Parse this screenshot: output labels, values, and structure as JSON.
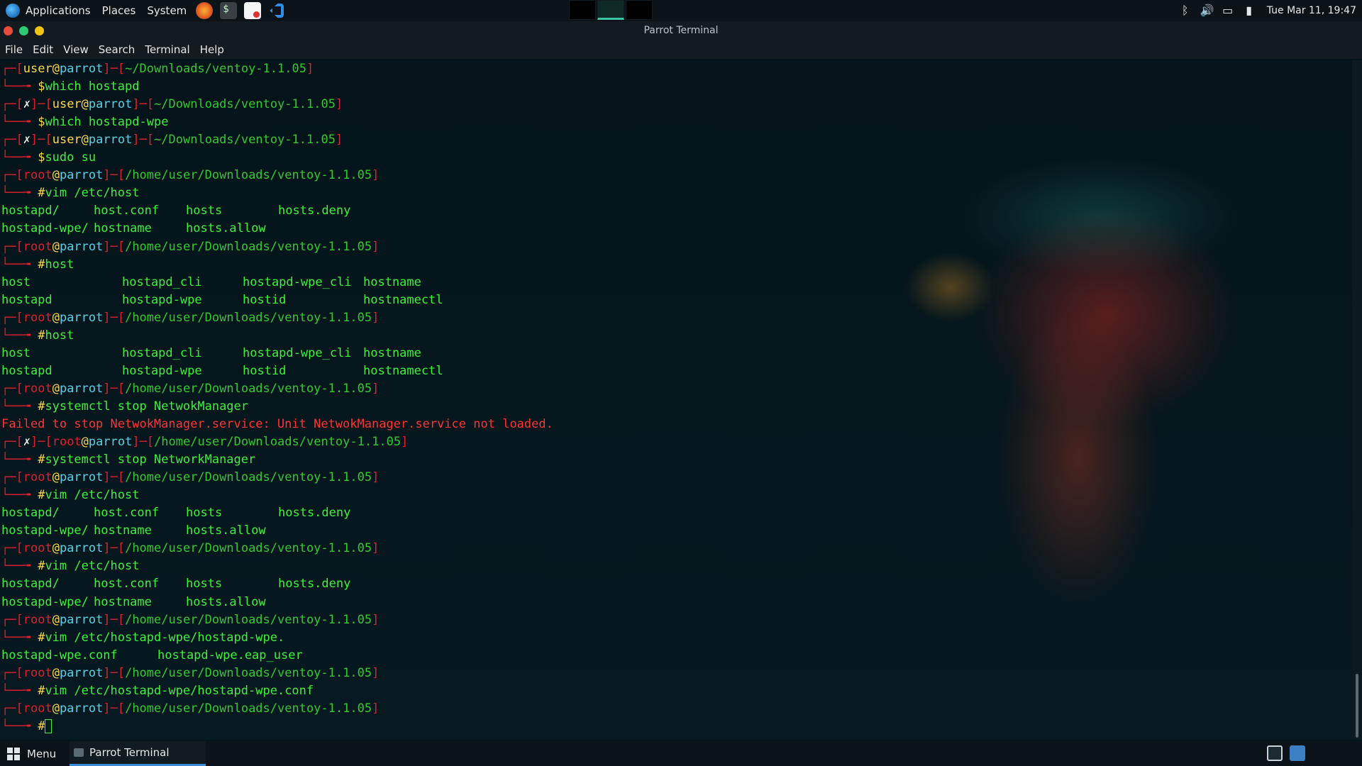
{
  "top_panel": {
    "menus": [
      "Applications",
      "Places",
      "System"
    ],
    "clock": "Tue Mar 11, 19:47"
  },
  "window": {
    "title": "Parrot Terminal",
    "menu": [
      "File",
      "Edit",
      "View",
      "Search",
      "Terminal",
      "Help"
    ]
  },
  "terminal": {
    "lines": [
      {
        "type": "prompt",
        "fail": false,
        "user": "user",
        "host": "parrot",
        "path": "~/Downloads/ventoy-1.1.05"
      },
      {
        "type": "cmd",
        "sym": "$",
        "text": "which hostapd"
      },
      {
        "type": "prompt",
        "fail": true,
        "user": "user",
        "host": "parrot",
        "path": "~/Downloads/ventoy-1.1.05"
      },
      {
        "type": "cmd",
        "sym": "$",
        "text": "which hostapd-wpe"
      },
      {
        "type": "prompt",
        "fail": true,
        "user": "user",
        "host": "parrot",
        "path": "~/Downloads/ventoy-1.1.05"
      },
      {
        "type": "cmd",
        "sym": "$",
        "text": "sudo su"
      },
      {
        "type": "prompt",
        "fail": false,
        "user": "root",
        "host": "parrot",
        "path": "/home/user/Downloads/ventoy-1.1.05"
      },
      {
        "type": "cmd",
        "sym": "#",
        "text": "vim /etc/host"
      },
      {
        "type": "cols",
        "cols": [
          "hostapd/",
          "host.conf",
          "hosts",
          "hosts.deny"
        ]
      },
      {
        "type": "cols",
        "cols": [
          "hostapd-wpe/",
          "hostname",
          "hosts.allow",
          ""
        ]
      },
      {
        "type": "prompt",
        "fail": false,
        "user": "root",
        "host": "parrot",
        "path": "/home/user/Downloads/ventoy-1.1.05"
      },
      {
        "type": "cmd",
        "sym": "#",
        "text": "host"
      },
      {
        "type": "cols4",
        "cols": [
          "host",
          "hostapd_cli",
          "hostapd-wpe_cli",
          "hostname"
        ]
      },
      {
        "type": "cols4",
        "cols": [
          "hostapd",
          "hostapd-wpe",
          "hostid",
          "hostnamectl"
        ]
      },
      {
        "type": "prompt",
        "fail": false,
        "user": "root",
        "host": "parrot",
        "path": "/home/user/Downloads/ventoy-1.1.05"
      },
      {
        "type": "cmd",
        "sym": "#",
        "text": "host"
      },
      {
        "type": "cols4",
        "cols": [
          "host",
          "hostapd_cli",
          "hostapd-wpe_cli",
          "hostname"
        ]
      },
      {
        "type": "cols4",
        "cols": [
          "hostapd",
          "hostapd-wpe",
          "hostid",
          "hostnamectl"
        ]
      },
      {
        "type": "prompt",
        "fail": false,
        "user": "root",
        "host": "parrot",
        "path": "/home/user/Downloads/ventoy-1.1.05"
      },
      {
        "type": "cmd",
        "sym": "#",
        "text": "systemctl stop NetwokManager"
      },
      {
        "type": "error",
        "text": "Failed to stop NetwokManager.service: Unit NetwokManager.service not loaded."
      },
      {
        "type": "prompt",
        "fail": true,
        "user": "root",
        "host": "parrot",
        "path": "/home/user/Downloads/ventoy-1.1.05"
      },
      {
        "type": "cmd",
        "sym": "#",
        "text": "systemctl stop NetworkManager"
      },
      {
        "type": "prompt",
        "fail": false,
        "user": "root",
        "host": "parrot",
        "path": "/home/user/Downloads/ventoy-1.1.05"
      },
      {
        "type": "cmd",
        "sym": "#",
        "text": "vim /etc/host"
      },
      {
        "type": "cols",
        "cols": [
          "hostapd/",
          "host.conf",
          "hosts",
          "hosts.deny"
        ]
      },
      {
        "type": "cols",
        "cols": [
          "hostapd-wpe/",
          "hostname",
          "hosts.allow",
          ""
        ]
      },
      {
        "type": "prompt",
        "fail": false,
        "user": "root",
        "host": "parrot",
        "path": "/home/user/Downloads/ventoy-1.1.05"
      },
      {
        "type": "cmd",
        "sym": "#",
        "text": "vim /etc/host"
      },
      {
        "type": "cols",
        "cols": [
          "hostapd/",
          "host.conf",
          "hosts",
          "hosts.deny"
        ]
      },
      {
        "type": "cols",
        "cols": [
          "hostapd-wpe/",
          "hostname",
          "hosts.allow",
          ""
        ]
      },
      {
        "type": "prompt",
        "fail": false,
        "user": "root",
        "host": "parrot",
        "path": "/home/user/Downloads/ventoy-1.1.05"
      },
      {
        "type": "cmd",
        "sym": "#",
        "text": "vim /etc/hostapd-wpe/hostapd-wpe."
      },
      {
        "type": "cols2",
        "cols": [
          "hostapd-wpe.conf",
          "hostapd-wpe.eap_user"
        ]
      },
      {
        "type": "prompt",
        "fail": false,
        "user": "root",
        "host": "parrot",
        "path": "/home/user/Downloads/ventoy-1.1.05"
      },
      {
        "type": "cmd",
        "sym": "#",
        "text": "vim /etc/hostapd-wpe/hostapd-wpe.conf"
      },
      {
        "type": "prompt",
        "fail": false,
        "user": "root",
        "host": "parrot",
        "path": "/home/user/Downloads/ventoy-1.1.05"
      },
      {
        "type": "input",
        "sym": "#",
        "text": ""
      }
    ]
  },
  "bottom_panel": {
    "menu_label": "Menu",
    "task_label": "Parrot Terminal"
  },
  "colors": {
    "prompt_bracket": "#e0202e",
    "host": "#56d3e8",
    "command": "#3cf03c",
    "error": "#ff3333",
    "accent": "#3d8bd4"
  }
}
